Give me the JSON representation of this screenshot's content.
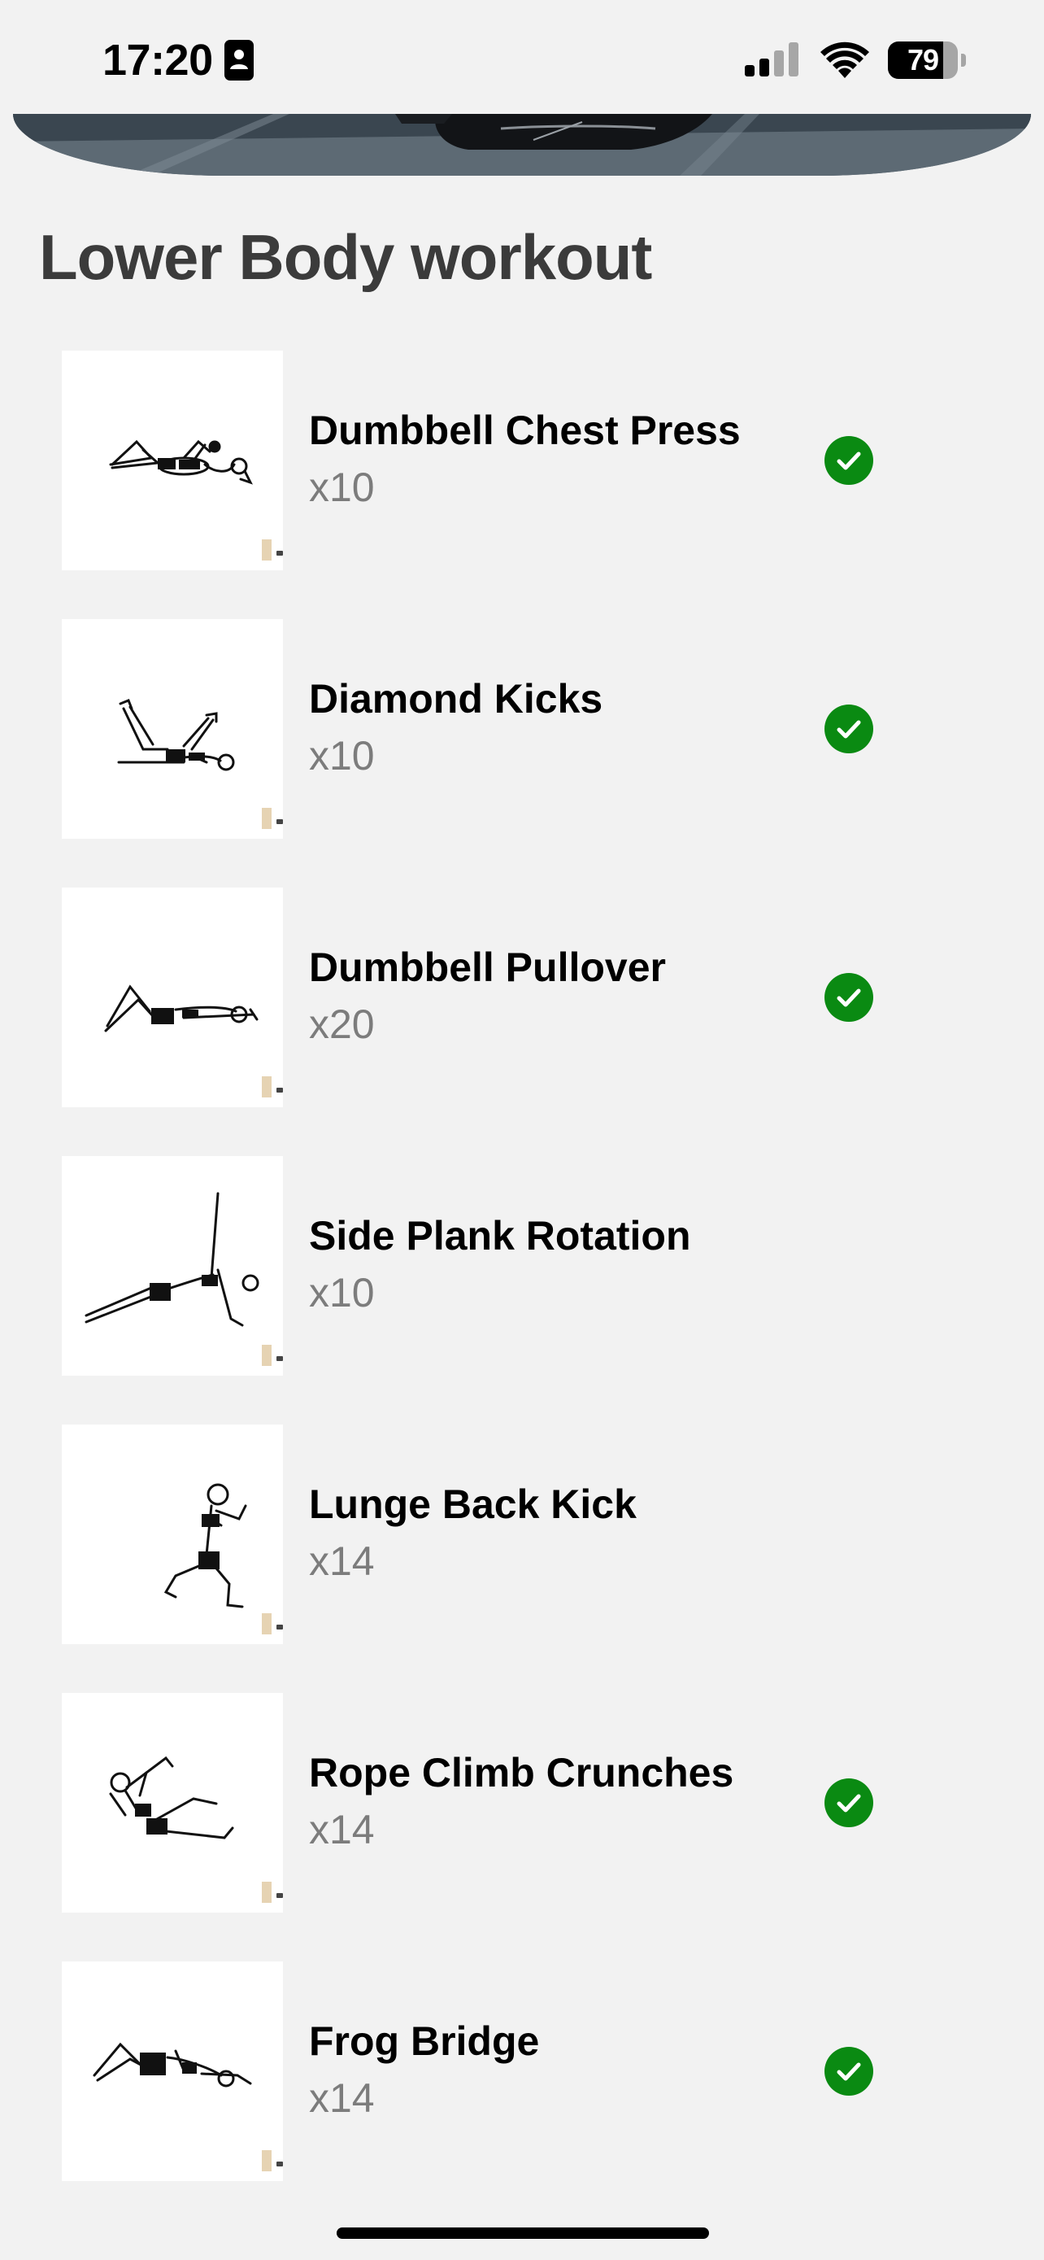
{
  "status_bar": {
    "time": "17:20",
    "battery": "79",
    "battery_level": 0.79,
    "icons": [
      "focus-person-icon",
      "cellular-signal-icon",
      "wifi-icon",
      "battery-icon"
    ]
  },
  "page": {
    "title": "Lower Body workout"
  },
  "exercises": [
    {
      "name": "Dumbbell Chest Press",
      "reps": "x10",
      "completed": true,
      "illustration": "dumbbell-chest-press-illustration"
    },
    {
      "name": "Diamond Kicks",
      "reps": "x10",
      "completed": true,
      "illustration": "diamond-kicks-illustration"
    },
    {
      "name": "Dumbbell Pullover",
      "reps": "x20",
      "completed": true,
      "illustration": "dumbbell-pullover-illustration"
    },
    {
      "name": "Side Plank Rotation",
      "reps": "x10",
      "completed": false,
      "illustration": "side-plank-rotation-illustration"
    },
    {
      "name": "Lunge Back Kick",
      "reps": "x14",
      "completed": false,
      "illustration": "lunge-back-kick-illustration"
    },
    {
      "name": "Rope Climb Crunches",
      "reps": "x14",
      "completed": true,
      "illustration": "rope-climb-crunches-illustration"
    },
    {
      "name": "Frog Bridge",
      "reps": "x14",
      "completed": true,
      "illustration": "frog-bridge-illustration"
    }
  ],
  "colors": {
    "background": "#f2f2f2",
    "title": "#3b3b3b",
    "reps_text": "#7c7c7c",
    "check_green": "#0a8a12"
  }
}
